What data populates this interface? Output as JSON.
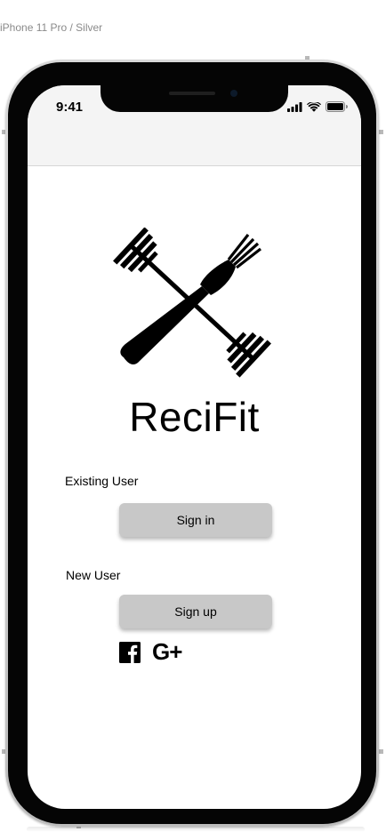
{
  "device_frame": {
    "label": "iPhone 11 Pro / Silver"
  },
  "status_bar": {
    "time": "9:41",
    "icons": [
      "cellular-signal-icon",
      "wifi-icon",
      "battery-icon"
    ]
  },
  "logo": {
    "icon": "crossed-barbell-fork-icon",
    "app_name": "ReciFit"
  },
  "existing_user": {
    "label": "Existing User",
    "button_label": "Sign in"
  },
  "new_user": {
    "label": "New User",
    "button_label": "Sign up"
  },
  "social_login": {
    "facebook_icon": "facebook-icon",
    "google_label": "G+"
  },
  "colors": {
    "button_background": "#c8c8c8",
    "navbar_background": "#f4f4f4",
    "device_body": "#050505",
    "text": "#000000"
  }
}
